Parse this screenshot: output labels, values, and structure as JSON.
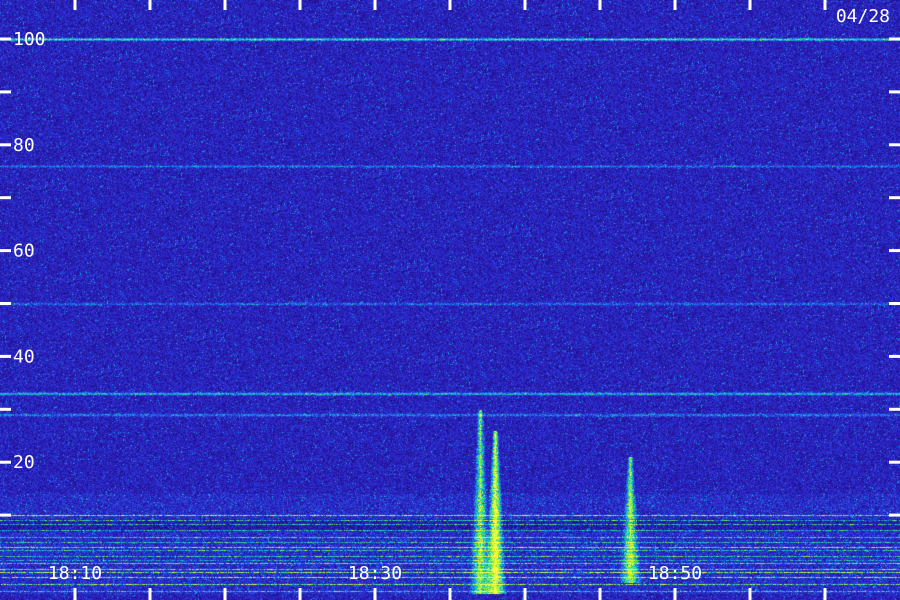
{
  "chart_data": {
    "type": "heatmap",
    "date_label": "04/28",
    "y_axis": {
      "range": [
        0,
        100
      ],
      "labeled_ticks": [
        20,
        40,
        60,
        80,
        100
      ],
      "minor_ticks": [
        10,
        30,
        50,
        70,
        90
      ],
      "tick_labels": [
        "20",
        "40",
        "60",
        "80",
        "100"
      ]
    },
    "x_axis": {
      "time_range": [
        "18:05",
        "19:05"
      ],
      "tick_labels": [
        "18:10",
        "18:30",
        "18:50"
      ],
      "labeled_ticks": [
        "18:10",
        "18:30",
        "18:50"
      ],
      "ticks": [
        "18:10",
        "18:15",
        "18:20",
        "18:25",
        "18:30",
        "18:35",
        "18:40",
        "18:45",
        "18:50",
        "18:55",
        "19:00"
      ]
    },
    "colormap": [
      "#000000",
      "#1e0a78",
      "#2a1ab4",
      "#2b3ce0",
      "#10a0e8",
      "#20e0a0",
      "#a0f020",
      "#ffff40"
    ],
    "features": [
      {
        "kind": "band",
        "y": 100,
        "intensity": 0.55
      },
      {
        "kind": "band",
        "y": 76,
        "intensity": 0.25
      },
      {
        "kind": "band",
        "y": 50,
        "intensity": 0.25
      },
      {
        "kind": "band",
        "y": 33,
        "intensity": 0.45
      },
      {
        "kind": "band",
        "y": 29,
        "intensity": 0.3
      },
      {
        "kind": "noise_floor",
        "y_range": [
          0,
          14
        ],
        "intensity": 0.8
      },
      {
        "kind": "burst",
        "time": "18:38",
        "y_range": [
          0,
          26
        ],
        "intensity": 1.0
      },
      {
        "kind": "burst",
        "time": "18:37",
        "y_range": [
          0,
          30
        ],
        "intensity": 0.7
      },
      {
        "kind": "burst",
        "time": "18:47",
        "y_range": [
          2,
          21
        ],
        "intensity": 0.75
      }
    ]
  }
}
